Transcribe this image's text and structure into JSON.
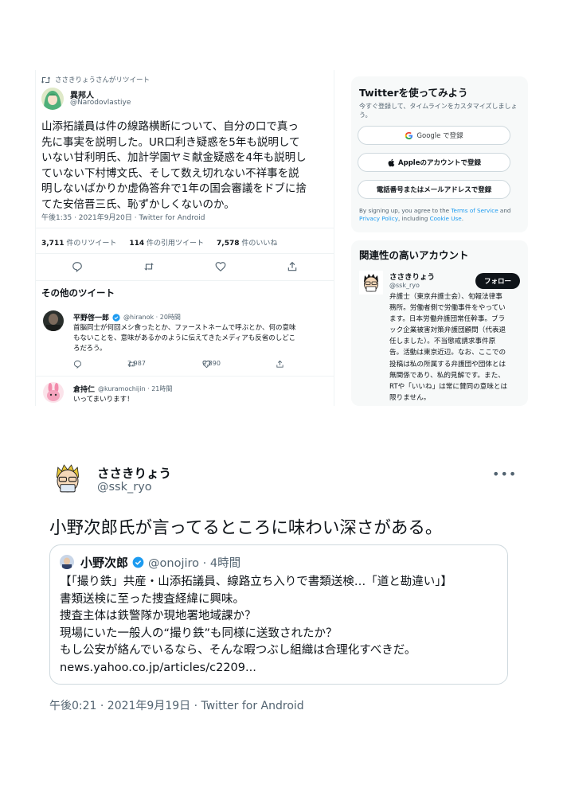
{
  "main": {
    "retweet_label": "ささきりょうさんがリツイート",
    "tweet": {
      "display_name": "異邦人",
      "handle": "@Narodovlastiye",
      "lines": [
        "山添拓議員は件の線路横断について、自分の口で真っ",
        "先に事実を説明した。UR口利き疑惑を5年も説明して",
        "いない甘利明氏、加計学園ヤミ献金疑惑を4年も説明し",
        "ていない下村博文氏、そして数え切れない不祥事を説",
        "明しないばかりか虚偽答弁で1年の国会審議をドブに捨",
        "てた安倍晋三氏、恥ずかしくないのか。"
      ],
      "meta": "午後1:35 · 2021年9月20日 · Twitter for Android",
      "stats": {
        "retweets_count": "3,711",
        "retweets_label": "件のリツイート",
        "quotes_count": "114",
        "quotes_label": "件の引用ツイート",
        "likes_count": "7,578",
        "likes_label": "件のいいね"
      }
    },
    "other_title": "その他のツイート",
    "others": [
      {
        "display_name": "平野啓一郎",
        "handle_time": "@hiranok · 20時間",
        "lines": [
          "首脳同士が何回メシ食ったとか、ファーストネームで呼ぶとか、何の意味",
          "もないことを、意味があるかのように伝えてきたメディアも反省のしどこ",
          "ろだろう。"
        ],
        "retweets": "2,987",
        "likes": "9,890"
      },
      {
        "display_name": "倉持仁",
        "handle_time": "@kuramochijin · 21時間",
        "lines": [
          "いってまいります！"
        ]
      }
    ]
  },
  "sidebar": {
    "signup": {
      "title": "Twitterを使ってみよう",
      "subtitle_lines": [
        "今すぐ登録して、タイムラインをカスタマイズしましょ",
        "う。"
      ],
      "google_label": "Google で登録",
      "apple_label": "Appleのアカウントで登録",
      "phone_label": "電話番号またはメールアドレスで登録",
      "legal_prefix": "By signing up, you agree to the ",
      "terms": "Terms of Service",
      "and": " and",
      "privacy": "Privacy Policy",
      "including": ", including ",
      "cookie": "Cookie Use",
      "period": "."
    },
    "related": {
      "title": "関連性の高いアカウント",
      "display_name": "ささきりょう",
      "handle": "@ssk_ryo",
      "follow_label": "フォロー",
      "bio_lines": [
        "弁護士（東京弁護士会）、旬報法律事",
        "務所。労働者側で労働事件をやってい",
        "ます。日本労働弁護団常任幹事。ブラ",
        "ック企業被害対策弁護団顧問（代表退",
        "任しました）。不当懲戒請求事件原",
        "告。活動は東京近辺。なお、ここでの",
        "投稿は私の所属する弁護団や団体とは",
        "無関係であり、私的見解です。また、",
        "RTや「いいね」は常に賛同の意味とは",
        "限りません。"
      ]
    }
  },
  "lower": {
    "display_name": "ささきりょう",
    "handle": "@ssk_ryo",
    "text": "小野次郎氏が言ってるところに味わい深さがある。",
    "quote": {
      "display_name": "小野次郎",
      "handle_time": "@onojiro · 4時間",
      "lines": [
        "【「撮り鉄」共産・山添拓議員、線路立ち入りで書類送検…「道と勘違い」】",
        "書類送検に至った捜査経緯に興味。",
        "捜査主体は鉄警隊か現地署地域課か？",
        "現場にいた一般人の“撮り鉄”も同様に送致されたか？",
        "もし公安が絡んでいるなら、そんな暇つぶし組織は合理化すべきだ。",
        "news.yahoo.co.jp/articles/c2209..."
      ]
    },
    "meta": "午後0:21 · 2021年9月19日 · Twitter for Android"
  },
  "colors": {
    "text": "#0f1419",
    "secondary": "#536471",
    "border": "#eff3f4",
    "twitter_blue": "#1d9bf0",
    "card_bg": "#f7f9f9"
  }
}
